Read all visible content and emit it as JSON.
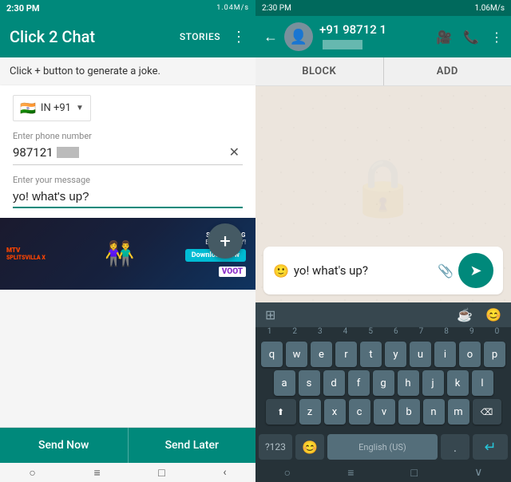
{
  "left": {
    "statusBar": {
      "time": "2:30 PM",
      "signal": "1.04M/s",
      "icons": "▲▼ ⊡ □□"
    },
    "header": {
      "title": "Click 2 Chat",
      "storiesLabel": "STORIES",
      "menuIcon": "⋮"
    },
    "hint": "Click + button to generate a joke.",
    "form": {
      "countryFlag": "🇮🇳",
      "countryCode": "IN +91",
      "dropdownArrow": "▼",
      "phoneLabel": "Enter phone number",
      "phoneValue": "987121",
      "clearIcon": "✕",
      "messageLabel": "Enter your message",
      "messageValue": "yo! what's up?"
    },
    "fab": "+",
    "ad": {
      "logo": "MTV\nSPLITSVILLA X",
      "streaming": "STREAMING",
      "exclusively": "EXCLUSIVELY!",
      "download": "Download Now",
      "voot": "VOOT"
    },
    "bottomButtons": {
      "sendNow": "Send Now",
      "sendLater": "Send Later"
    },
    "nav": [
      "○",
      "≡",
      "□",
      "‹"
    ]
  },
  "right": {
    "statusBar": {
      "time": "2:30 PM",
      "signal": "1.06M/s",
      "icons": "▲▼ ⊡ □□"
    },
    "header": {
      "backArrow": "←",
      "contactNumber": "+91 98712 1",
      "videoIcon": "📷",
      "callIcon": "📞",
      "menuIcon": "⋮"
    },
    "tabs": {
      "block": "BLOCK",
      "add": "ADD"
    },
    "messageBubble": {
      "emoji": "🙂",
      "text": "yo! what's up?",
      "attachIcon": "📎",
      "sendIcon": "➤"
    },
    "keyboard": {
      "topIcons": [
        "⊞",
        "☕",
        "😊"
      ],
      "numbers": [
        "1",
        "2",
        "3",
        "4",
        "5",
        "6",
        "7",
        "8",
        "9",
        "0"
      ],
      "row1": [
        "q",
        "w",
        "e",
        "r",
        "t",
        "y",
        "u",
        "i",
        "o",
        "p"
      ],
      "row2": [
        "a",
        "s",
        "d",
        "f",
        "g",
        "h",
        "j",
        "k",
        "l"
      ],
      "row3": [
        "z",
        "x",
        "c",
        "v",
        "b",
        "n",
        "m"
      ],
      "shiftIcon": "⬆",
      "backspaceIcon": "⌫",
      "num123": "?123",
      "emojiKey": "😊",
      "language": "English (US)",
      "period": ".",
      "enterIcon": "↵"
    },
    "nav": [
      "○",
      "≡",
      "□",
      "∨"
    ]
  }
}
